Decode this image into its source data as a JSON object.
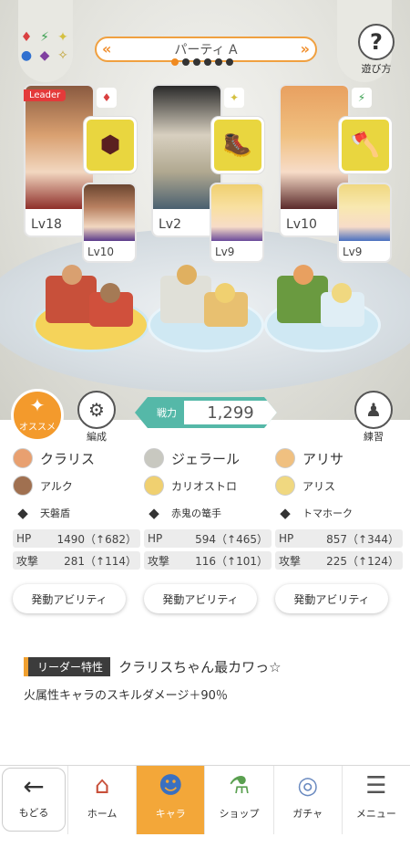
{
  "header": {
    "party_name": "パーティ A",
    "help_label": "遊び方",
    "page_count": 6,
    "active_page": 0,
    "element_icons": [
      "♦",
      "⚡",
      "✦",
      "●",
      "◆",
      "✧"
    ]
  },
  "cards": [
    {
      "leader_label": "Leader",
      "main_lv": "Lv18",
      "sub_lv": "Lv10",
      "element": "♦",
      "element_color": "#d94040",
      "equip_icon": "⬢",
      "main_color": "#d9a070",
      "sub_color": "#a57a55"
    },
    {
      "leader_label": "",
      "main_lv": "Lv2",
      "sub_lv": "Lv9",
      "element": "✦",
      "element_color": "#d4c040",
      "equip_icon": "🥾",
      "main_color": "#d8d0c0",
      "sub_color": "#f0d070"
    },
    {
      "leader_label": "",
      "main_lv": "Lv10",
      "sub_lv": "Lv9",
      "element": "⚡",
      "element_color": "#3aa050",
      "equip_icon": "🪓",
      "main_color": "#e8b080",
      "sub_color": "#f0d880"
    }
  ],
  "buttons": {
    "recommend": "オススメ",
    "edit": "編成",
    "practice": "練習"
  },
  "power": {
    "label": "戦力",
    "value": "1,299"
  },
  "members": [
    {
      "name": "クラリス",
      "sub": "アルク",
      "equip": "天磐盾",
      "hp_label": "HP",
      "hp": "1490（↑682）",
      "atk_label": "攻撃",
      "atk": "281（↑114）",
      "ability": "発動アビリティ",
      "avatar_color": "#e8a070",
      "sub_avatar_color": "#a07050"
    },
    {
      "name": "ジェラール",
      "sub": "カリオストロ",
      "equip": "赤鬼の篭手",
      "hp_label": "HP",
      "hp": "594（↑465）",
      "atk_label": "攻撃",
      "atk": "116（↑101）",
      "ability": "発動アビリティ",
      "avatar_color": "#c8c8c0",
      "sub_avatar_color": "#f0d070"
    },
    {
      "name": "アリサ",
      "sub": "アリス",
      "equip": "トマホーク",
      "hp_label": "HP",
      "hp": "857（↑344）",
      "atk_label": "攻撃",
      "atk": "225（↑124）",
      "ability": "発動アビリティ",
      "avatar_color": "#f0c080",
      "sub_avatar_color": "#f0d880"
    }
  ],
  "leader_trait": {
    "tag": "リーダー特性",
    "title": "クラリスちゃん最カワっ☆",
    "description": "火属性キャラのスキルダメージ＋90％"
  },
  "nav": {
    "back": "もどる",
    "tabs": [
      {
        "label": "ホーム",
        "icon": "⌂",
        "active": false
      },
      {
        "label": "キャラ",
        "icon": "☻",
        "active": true
      },
      {
        "label": "ショップ",
        "icon": "⚗",
        "active": false
      },
      {
        "label": "ガチャ",
        "icon": "◎",
        "active": false
      },
      {
        "label": "メニュー",
        "icon": "☰",
        "active": false
      }
    ]
  }
}
